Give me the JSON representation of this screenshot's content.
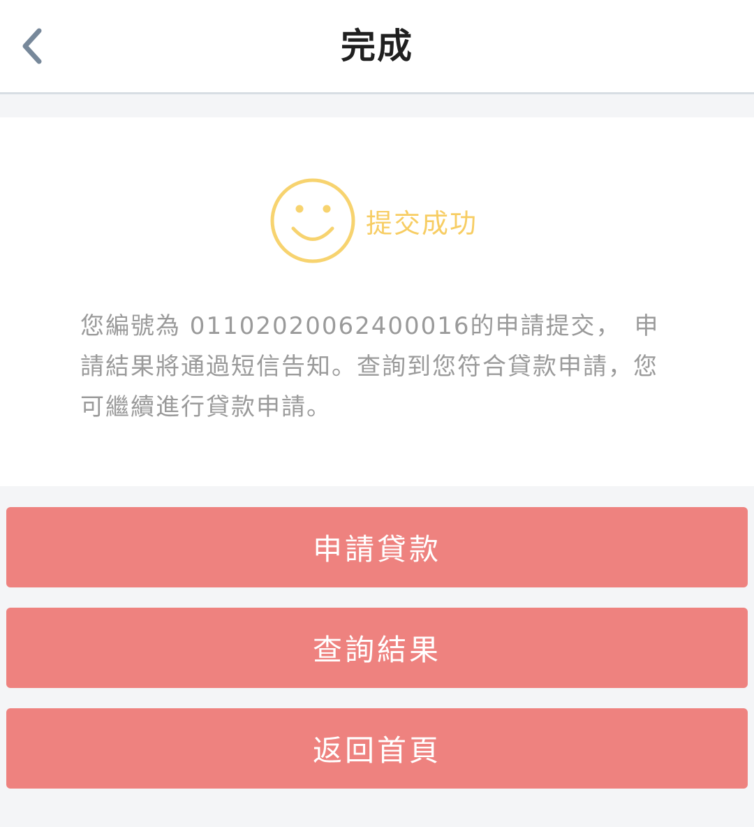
{
  "nav": {
    "title": "完成",
    "back_icon": "chevron-left-icon"
  },
  "result": {
    "icon": "smiley-face-icon",
    "status": "提交成功",
    "message": "您編號為 01102020062400016的申請提交，　申請結果將通過短信告知。查詢到您符合貸款申請，您可繼續進行貸款申請。"
  },
  "buttons": {
    "apply_loan": "申請貸款",
    "query_result": "查詢結果",
    "back_home": "返回首頁"
  },
  "colors": {
    "accent_button": "#ee827f",
    "success_yellow": "#f7cd63",
    "message_gray": "#9a9a9a",
    "page_background": "#f4f5f7"
  }
}
